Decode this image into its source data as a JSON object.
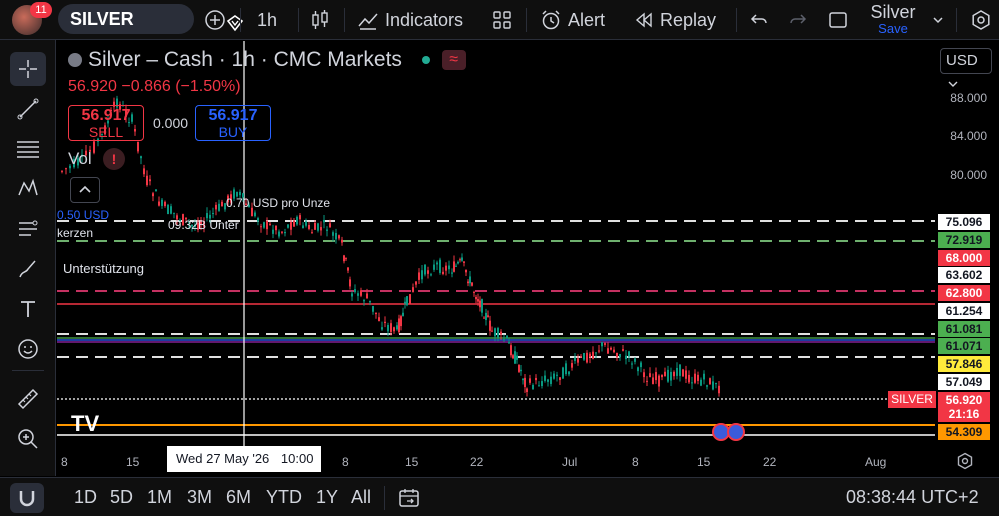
{
  "header": {
    "notification_count": "11",
    "symbol": "SILVER",
    "interval": "1h",
    "indicators_label": "Indicators",
    "alert_label": "Alert",
    "replay_label": "Replay",
    "layout_name": "Silver",
    "save_label": "Save"
  },
  "legend": {
    "title": "Silver – Cash · 1h · CMC Markets",
    "price_change": "56.920 −0.866 (−1.50%)",
    "sell_price": "56.917",
    "sell_label": "SELL",
    "spread": "0.000",
    "buy_price": "56.917",
    "buy_label": "BUY",
    "vol_label": "Vol",
    "vol_warning": "!"
  },
  "currency": "USD",
  "price_scale": {
    "ticks": [
      "88.000",
      "84.000",
      "80.000"
    ],
    "tags": [
      {
        "value": "75.096",
        "bg": "#ffffff",
        "fg": "#131722"
      },
      {
        "value": "72.919",
        "bg": "#4caf50",
        "fg": "#131722"
      },
      {
        "value": "68.000",
        "bg": "#f23645",
        "fg": "#ffffff"
      },
      {
        "value": "63.602",
        "bg": "#ffffff",
        "fg": "#131722"
      },
      {
        "value": "62.800",
        "bg": "#f23645",
        "fg": "#ffffff"
      },
      {
        "value": "61.254",
        "bg": "#ffffff",
        "fg": "#131722"
      },
      {
        "value": "61.081",
        "bg": "#4caf50",
        "fg": "#131722"
      },
      {
        "value": "61.071",
        "bg": "#4caf50",
        "fg": "#131722"
      },
      {
        "value": "57.846",
        "bg": "#ffeb3b",
        "fg": "#131722"
      },
      {
        "value": "57.049",
        "bg": "#ffffff",
        "fg": "#131722"
      },
      {
        "value": "56.920",
        "bg": "#f23645",
        "fg": "#ffffff"
      },
      {
        "value": "21:16",
        "bg": "#f23645",
        "fg": "#ffffff"
      },
      {
        "value": "54.309",
        "bg": "#ff9800",
        "fg": "#131722"
      }
    ],
    "symbol_tag": "SILVER"
  },
  "time_axis": {
    "labels": [
      "8",
      "15",
      "8",
      "15",
      "22",
      "Jul",
      "8",
      "15",
      "22",
      "Aug"
    ],
    "crosshair_date": "Wed 27 May '26",
    "crosshair_time": "10:00"
  },
  "annotations": {
    "a1": "0.50 USD",
    "a2": "kerzen",
    "a3": "Unterstützung",
    "a4": "0.70 USD pro Unze",
    "a5": "09.32B Unter"
  },
  "ranges": [
    "1D",
    "5D",
    "1M",
    "3M",
    "6M",
    "YTD",
    "1Y",
    "All"
  ],
  "clock": "08:38:44 UTC+2",
  "colors": {
    "up": "#089981",
    "down": "#f23645",
    "accent": "#2962ff"
  }
}
